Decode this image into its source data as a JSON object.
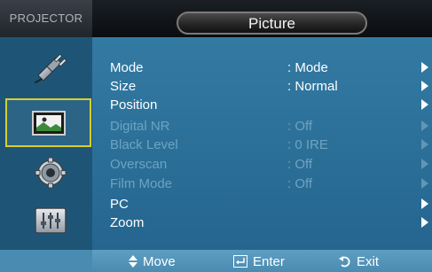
{
  "header": {
    "brand": "PROJECTOR",
    "title": "Picture"
  },
  "sidebar": {
    "items": [
      {
        "icon": "plug-icon"
      },
      {
        "icon": "picture-icon",
        "selected": true
      },
      {
        "icon": "gear-icon"
      },
      {
        "icon": "equalizer-icon"
      }
    ]
  },
  "menu": {
    "items": [
      {
        "label": "Mode",
        "value": ": Mode",
        "enabled": true
      },
      {
        "label": "Size",
        "value": ": Normal",
        "enabled": true
      },
      {
        "label": "Position",
        "value": "",
        "enabled": true
      },
      {
        "label": "Digital NR",
        "value": ": Off",
        "enabled": false
      },
      {
        "label": "Black Level",
        "value": ": 0 IRE",
        "enabled": false
      },
      {
        "label": "Overscan",
        "value": ": Off",
        "enabled": false
      },
      {
        "label": "Film Mode",
        "value": ": Off",
        "enabled": false
      },
      {
        "label": "PC",
        "value": "",
        "enabled": true
      },
      {
        "label": "Zoom",
        "value": "",
        "enabled": true
      }
    ]
  },
  "footer": {
    "move": "Move",
    "enter": "Enter",
    "exit": "Exit"
  },
  "colors": {
    "accent_border": "#d6cf2e",
    "panel": "#2a6e96",
    "disabled_text": "#6ea3c2"
  }
}
